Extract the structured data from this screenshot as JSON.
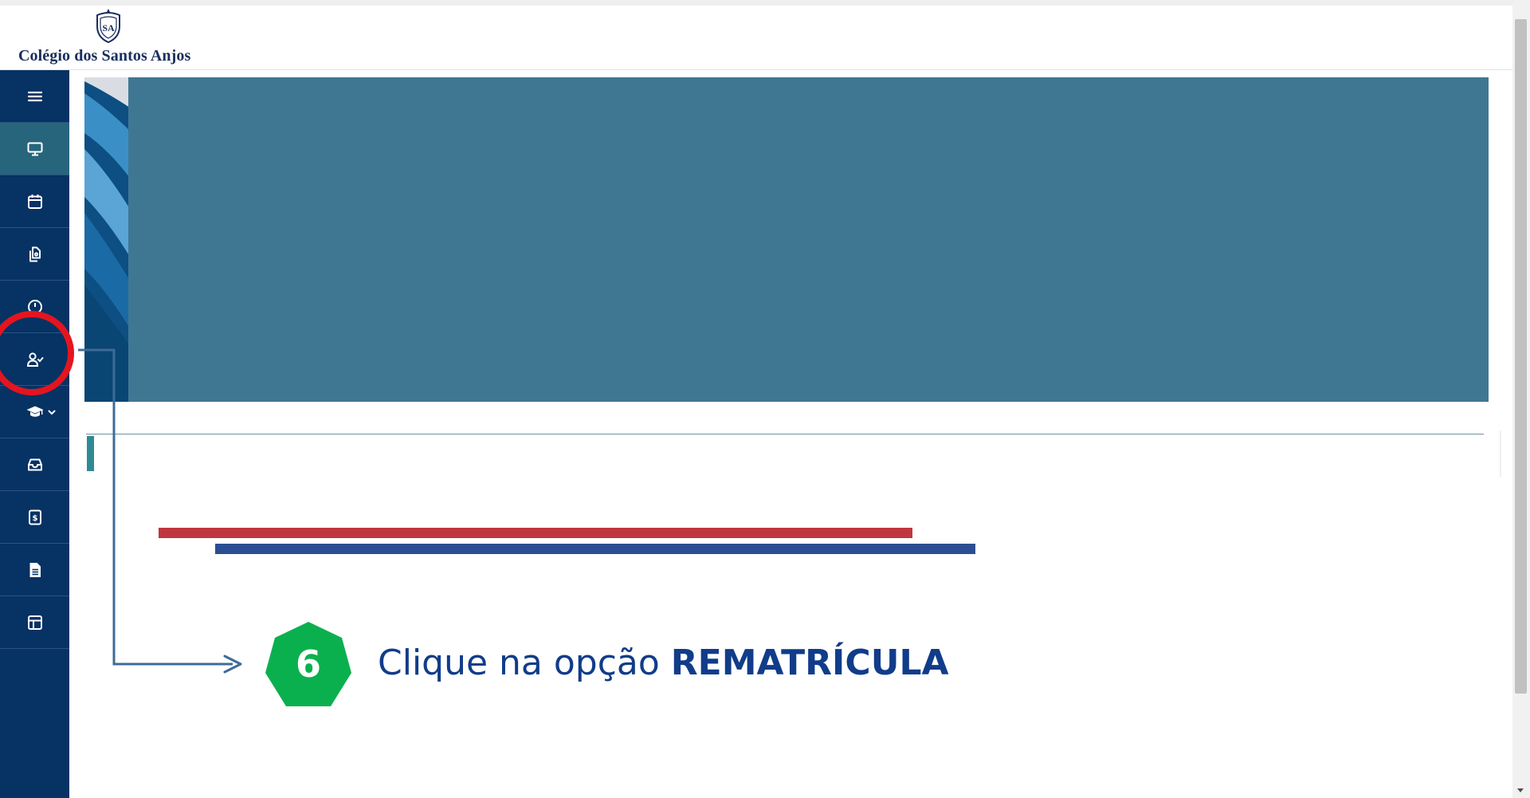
{
  "header": {
    "school_name": "Colégio dos Santos Anjos",
    "logo_icon": "crest-icon"
  },
  "sidebar": {
    "items": [
      {
        "icon": "menu-icon",
        "active": false
      },
      {
        "icon": "monitor-icon",
        "active": true
      },
      {
        "icon": "calendar-icon",
        "active": false
      },
      {
        "icon": "documents-icon",
        "active": false
      },
      {
        "icon": "clock-icon",
        "active": false
      },
      {
        "icon": "user-check-icon",
        "active": false,
        "highlighted": true
      },
      {
        "icon": "graduation-cap-icon",
        "active": false,
        "has_submenu": true
      },
      {
        "icon": "inbox-icon",
        "active": false
      },
      {
        "icon": "invoice-dollar-icon",
        "active": false
      },
      {
        "icon": "document-text-icon",
        "active": false
      },
      {
        "icon": "layout-icon",
        "active": false
      }
    ]
  },
  "instruction": {
    "step_number": "6",
    "text_prefix": "Clique na opção ",
    "text_bold": "REMATRÍCULA"
  },
  "colors": {
    "sidebar": "#063264",
    "sidebar_active": "#27657d",
    "banner": "#3f7793",
    "highlight_ring": "#e4151e",
    "step_badge": "#0bb04e",
    "instruction_text": "#113c8a",
    "bar_red": "#c0363f",
    "bar_blue": "#2b4e93"
  }
}
